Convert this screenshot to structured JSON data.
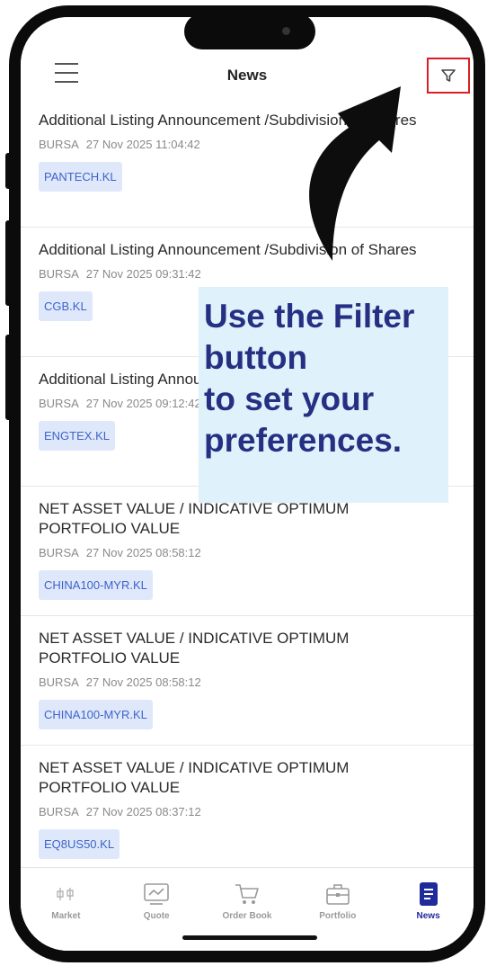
{
  "header": {
    "title": "News"
  },
  "news": [
    {
      "title": "Additional Listing Announcement /Subdivision of Shares",
      "source": "BURSA",
      "datetime": "27 Nov 2025 11:04:42",
      "ticker": "PANTECH.KL"
    },
    {
      "title": "Additional Listing Announcement /Subdivision of Shares",
      "source": "BURSA",
      "datetime": "27 Nov 2025 09:31:42",
      "ticker": "CGB.KL"
    },
    {
      "title": "Additional Listing Announcement /Subdivision of Shares",
      "source": "BURSA",
      "datetime": "27 Nov 2025 09:12:42",
      "ticker": "ENGTEX.KL"
    },
    {
      "title": "NET ASSET VALUE / INDICATIVE OPTIMUM PORTFOLIO VALUE",
      "source": "BURSA",
      "datetime": "27 Nov 2025 08:58:12",
      "ticker": "CHINA100-MYR.KL"
    },
    {
      "title": "NET ASSET VALUE / INDICATIVE OPTIMUM PORTFOLIO VALUE",
      "source": "BURSA",
      "datetime": "27 Nov 2025 08:58:12",
      "ticker": "CHINA100-MYR.KL"
    },
    {
      "title": "NET ASSET VALUE / INDICATIVE OPTIMUM PORTFOLIO VALUE",
      "source": "BURSA",
      "datetime": "27 Nov 2025 08:37:12",
      "ticker": "EQ8US50.KL"
    }
  ],
  "nav": [
    {
      "label": "Market",
      "icon": "market-icon"
    },
    {
      "label": "Quote",
      "icon": "chart-icon"
    },
    {
      "label": "Order Book",
      "icon": "cart-icon"
    },
    {
      "label": "Portfolio",
      "icon": "briefcase-icon"
    },
    {
      "label": "News",
      "icon": "news-icon",
      "active": true
    }
  ],
  "callout": {
    "text": "Use the Filter\nbutton\nto set your\npreferences."
  },
  "colors": {
    "accent": "#1f2a9b",
    "ticker_bg": "#dfe8fb",
    "highlight": "#d81f26",
    "callout_bg": "#dff1fb"
  }
}
